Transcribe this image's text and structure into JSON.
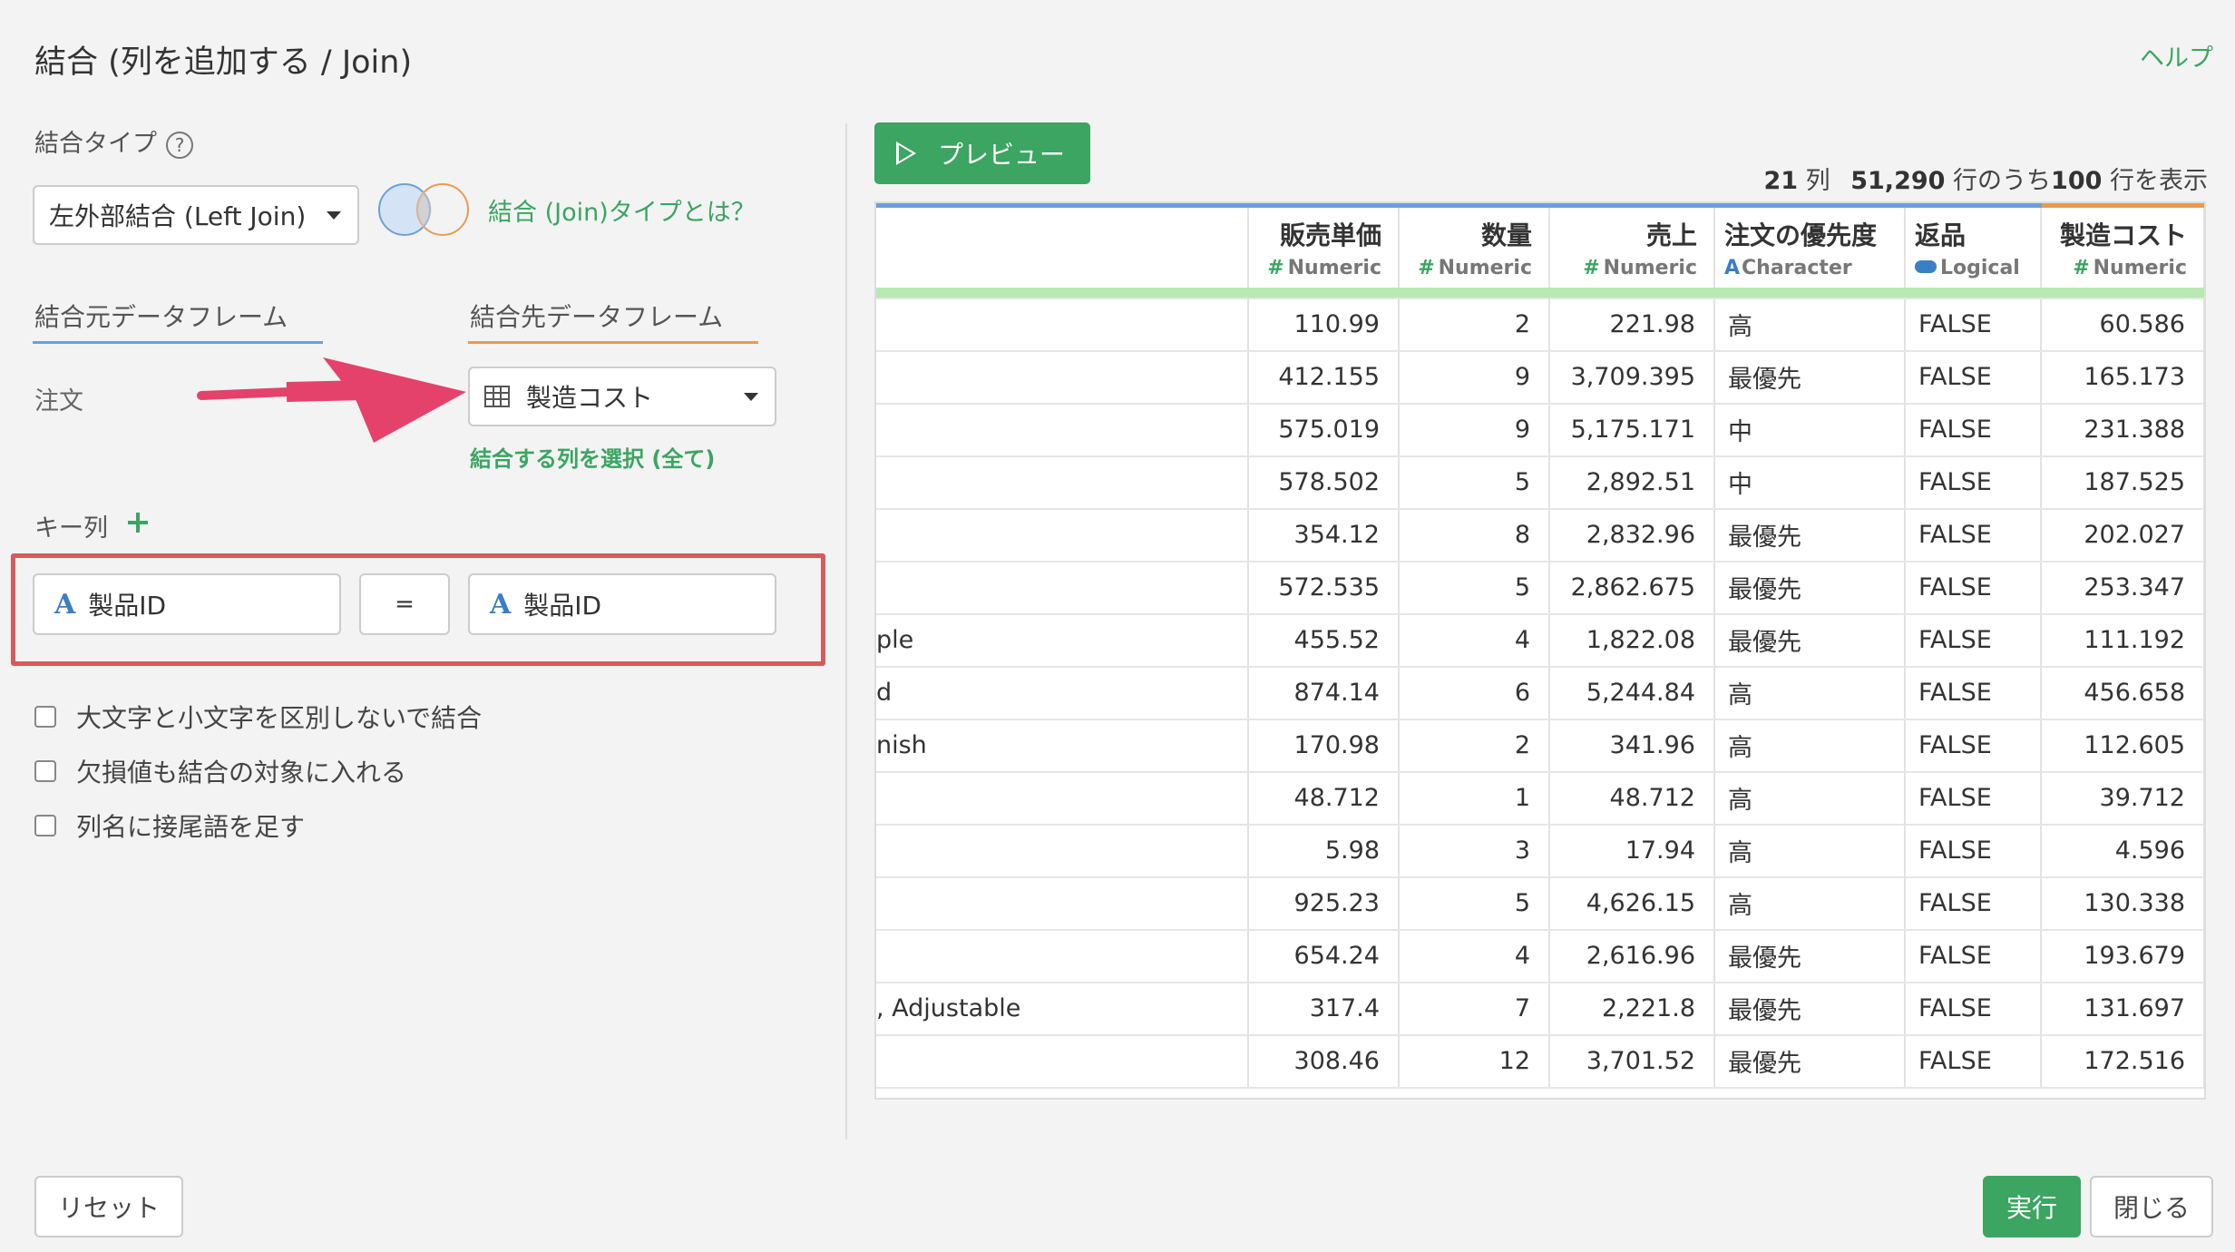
{
  "dialog": {
    "title": "結合 (列を追加する / Join)",
    "help_link": "ヘルプ"
  },
  "join_type": {
    "label": "結合タイプ",
    "help_icon": "question-circle-icon",
    "selected": "左外部結合 (Left Join)",
    "info_link": "結合 (Join)タイプとは？"
  },
  "dataframes": {
    "source_tab": "結合元データフレーム",
    "target_tab": "結合先データフレーム",
    "source_name": "注文",
    "target_selected": "製造コスト",
    "select_columns_link": "結合する列を選択 (全て)",
    "source_color": "#6d9fd6",
    "target_color": "#e89a52",
    "arrow_color": "#e5426b"
  },
  "keys": {
    "label": "キー列",
    "add_icon": "plus-icon",
    "left_column": "製品ID",
    "operator": "=",
    "right_column": "製品ID",
    "type_icon": "character-type-icon"
  },
  "options": [
    "大文字と小文字を区別しないで結合",
    "欠損値も結合の対象に入れる",
    "列名に接尾語を足す"
  ],
  "buttons": {
    "reset": "リセット",
    "run": "実行",
    "close": "閉じる",
    "preview": "プレビュー"
  },
  "summary": {
    "cols": "21",
    "cols_unit": "列",
    "rows_total": "51,290",
    "rows_mid": "行のうち",
    "rows_shown": "100",
    "rows_suffix": "行を表示"
  },
  "table": {
    "columns": [
      {
        "name": "",
        "type": ""
      },
      {
        "name": "販売単価",
        "type": "Numeric"
      },
      {
        "name": "数量",
        "type": "Numeric"
      },
      {
        "name": "売上",
        "type": "Numeric"
      },
      {
        "name": "注文の優先度",
        "type": "Character"
      },
      {
        "name": "返品",
        "type": "Logical"
      },
      {
        "name": "製造コスト",
        "type": "Numeric"
      }
    ],
    "rows": [
      [
        "",
        "110.99",
        "2",
        "221.98",
        "高",
        "FALSE",
        "60.586"
      ],
      [
        "",
        "412.155",
        "9",
        "3,709.395",
        "最優先",
        "FALSE",
        "165.173"
      ],
      [
        "",
        "575.019",
        "9",
        "5,175.171",
        "中",
        "FALSE",
        "231.388"
      ],
      [
        "",
        "578.502",
        "5",
        "2,892.51",
        "中",
        "FALSE",
        "187.525"
      ],
      [
        "",
        "354.12",
        "8",
        "2,832.96",
        "最優先",
        "FALSE",
        "202.027"
      ],
      [
        "",
        "572.535",
        "5",
        "2,862.675",
        "最優先",
        "FALSE",
        "253.347"
      ],
      [
        "ple",
        "455.52",
        "4",
        "1,822.08",
        "最優先",
        "FALSE",
        "111.192"
      ],
      [
        "d",
        "874.14",
        "6",
        "5,244.84",
        "高",
        "FALSE",
        "456.658"
      ],
      [
        "nish",
        "170.98",
        "2",
        "341.96",
        "高",
        "FALSE",
        "112.605"
      ],
      [
        "",
        "48.712",
        "1",
        "48.712",
        "高",
        "FALSE",
        "39.712"
      ],
      [
        "",
        "5.98",
        "3",
        "17.94",
        "高",
        "FALSE",
        "4.596"
      ],
      [
        "",
        "925.23",
        "5",
        "4,626.15",
        "高",
        "FALSE",
        "130.338"
      ],
      [
        "",
        "654.24",
        "4",
        "2,616.96",
        "最優先",
        "FALSE",
        "193.679"
      ],
      [
        ", Adjustable",
        "317.4",
        "7",
        "2,221.8",
        "最優先",
        "FALSE",
        "131.697"
      ],
      [
        "",
        "308.46",
        "12",
        "3,701.52",
        "最優先",
        "FALSE",
        "172.516"
      ]
    ]
  }
}
